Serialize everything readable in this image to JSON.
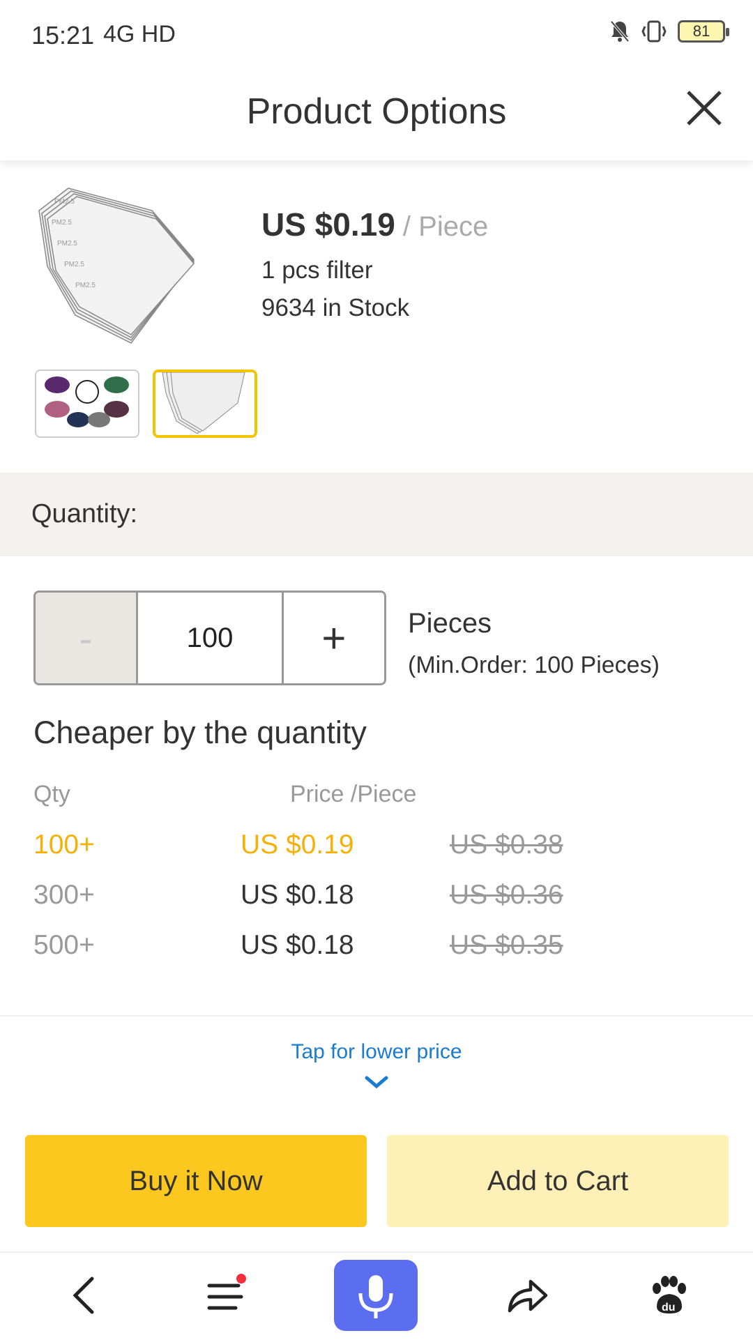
{
  "status_bar": {
    "time": "15:21",
    "network": "4G HD",
    "battery": "81"
  },
  "header": {
    "title": "Product Options"
  },
  "product": {
    "price": "US $0.19",
    "price_unit": " / Piece",
    "description": "1 pcs filter",
    "stock": "9634 in Stock"
  },
  "quantity": {
    "label": "Quantity:",
    "minus": "-",
    "value": "100",
    "plus": "+",
    "unit": "Pieces",
    "min_order": "(Min.Order: 100 Pieces)"
  },
  "tiers": {
    "title": "Cheaper by the quantity",
    "col_qty": "Qty",
    "col_price": "Price /Piece",
    "rows": [
      {
        "qty": "100+",
        "price": "US $0.19",
        "original": "US $0.38"
      },
      {
        "qty": "300+",
        "price": "US $0.18",
        "original": "US $0.36"
      },
      {
        "qty": "500+",
        "price": "US $0.18",
        "original": "US $0.35"
      }
    ]
  },
  "lower_price_link": "Tap for lower price",
  "actions": {
    "buy": "Buy it Now",
    "cart": "Add to Cart"
  },
  "colors": {
    "accent": "#fcc81f",
    "accent_light": "#fff0b8",
    "tier_active": "#f5b10a",
    "link": "#1a7bd1",
    "mic": "#5b6ef0"
  },
  "nav_icons": [
    "back-icon",
    "menu-icon",
    "microphone-icon",
    "share-icon",
    "paw-icon"
  ]
}
